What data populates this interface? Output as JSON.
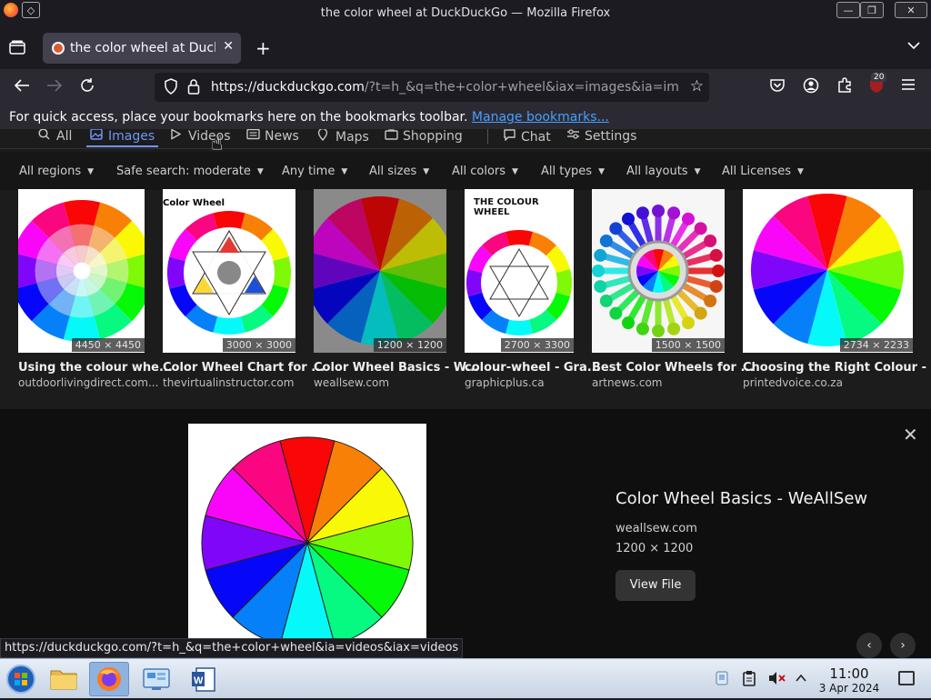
{
  "window": {
    "title": "the color wheel at DuckDuckGo — Mozilla Firefox",
    "minimize": "—",
    "restore": "❐",
    "close": "✕"
  },
  "tabs": [
    {
      "label": "the color wheel at DuckDuckGo",
      "active": true
    }
  ],
  "nav": {
    "url_host": "https://duckduckgo.com",
    "url_rest": "/?t=h_&q=the+color+wheel&iax=images&ia=images",
    "extensions_badge": "20"
  },
  "bookmarks_bar": {
    "message": "For quick access, place your bookmarks here on the bookmarks toolbar.",
    "link": "Manage bookmarks..."
  },
  "search_tabs": [
    {
      "label": "All",
      "icon": "search-icon"
    },
    {
      "label": "Images",
      "icon": "image-icon",
      "active": true
    },
    {
      "label": "Videos",
      "icon": "play-icon"
    },
    {
      "label": "News",
      "icon": "news-icon"
    },
    {
      "label": "Maps",
      "icon": "map-pin-icon"
    },
    {
      "label": "Shopping",
      "icon": "bag-icon"
    },
    {
      "label": "Chat",
      "icon": "chat-icon"
    },
    {
      "label": "Settings",
      "icon": "settings-icon"
    }
  ],
  "filters": [
    "All regions",
    "Safe search: moderate",
    "Any time",
    "All sizes",
    "All colors",
    "All types",
    "All layouts",
    "All Licenses"
  ],
  "results": [
    {
      "caption": "Using the colour whe...",
      "source": "outdoorlivingdirect.com...",
      "dims": "4450 × 4450"
    },
    {
      "caption": "Color Wheel Chart for ...",
      "source": "thevirtualinstructor.com",
      "dims": "3000 × 3000",
      "inner_label": "Color Wheel"
    },
    {
      "caption": "Color Wheel Basics - W...",
      "source": "weallsew.com",
      "dims": "1200 × 1200"
    },
    {
      "caption": "colour-wheel - Gra...",
      "source": "graphicplus.ca",
      "dims": "2700 × 3300",
      "inner_label": "THE COLOUR WHEEL"
    },
    {
      "caption": "Best Color Wheels for ...",
      "source": "artnews.com",
      "dims": "1500 × 1500"
    },
    {
      "caption": "Choosing the Right Colour - P...",
      "source": "printedvoice.co.za",
      "dims": "2734 × 2233"
    }
  ],
  "detail": {
    "title": "Color Wheel Basics - WeAllSew",
    "site": "weallsew.com",
    "dims": "1200 × 1200",
    "view_button": "View File"
  },
  "status_url": "https://duckduckgo.com/?t=h_&q=the+color+wheel&ia=videos&iax=videos",
  "clock": {
    "time": "11:00",
    "date": "3 Apr 2024"
  }
}
